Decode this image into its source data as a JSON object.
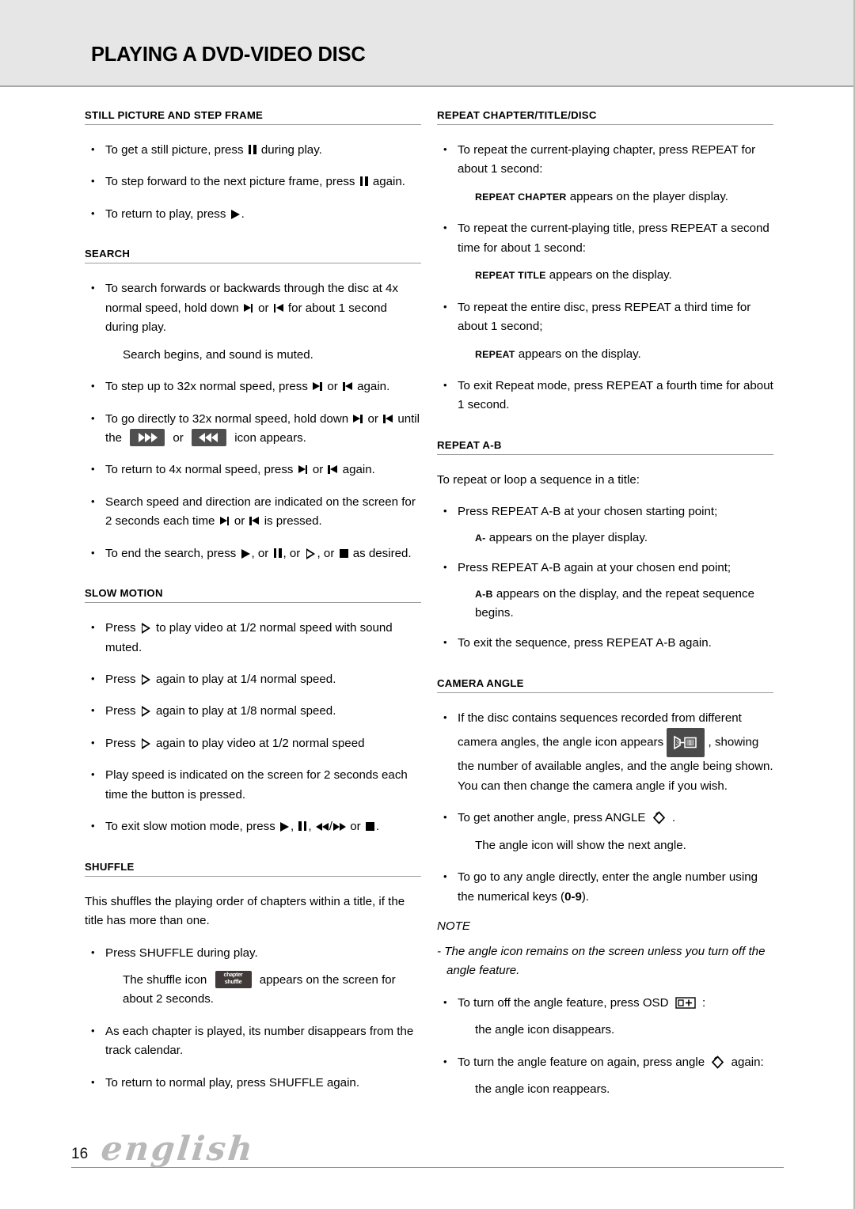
{
  "header": {
    "title": "PLAYING A DVD-VIDEO DISC"
  },
  "footer": {
    "page_number": "16",
    "language": "english"
  },
  "icons": {
    "pause": "pause-icon",
    "play": "play-icon",
    "slow": "slow-play-icon",
    "stop": "stop-icon",
    "next": "next-track-icon",
    "prev": "previous-track-icon",
    "rewind": "rewind-icon",
    "fast_forward": "fast-forward-icon",
    "angle": "camera-angle-icon",
    "osd": "osd-icon",
    "shuffle_box_line1": "chapter",
    "shuffle_box_line2": "shuffle"
  },
  "left_column": {
    "sections": [
      {
        "id": "still-picture-and-step-frame",
        "heading": "STILL PICTURE AND STEP FRAME",
        "items": [
          {
            "a": "To get a still picture, press",
            "b": "during play."
          },
          {
            "a": "To step forward to the next picture frame, press",
            "b": "again."
          },
          {
            "a": "To return to play, press",
            "b": "."
          }
        ]
      },
      {
        "id": "search",
        "heading": "SEARCH",
        "b1a": "To search forwards or backwards through the disc at 4x normal speed, hold down",
        "b1b": "or",
        "b1c": "for about 1 second during play.",
        "b1_sub": "Search begins, and sound is muted.",
        "b2a": "To step up to 32x normal speed, press",
        "b2b": "or",
        "b2c": "again.",
        "b3a": "To go directly to 32x normal speed, hold down",
        "b3b": "or",
        "b3c": "until the",
        "b3d": "or",
        "b3e": "icon appears.",
        "b4a": "To return to 4x normal speed, press",
        "b4b": "or",
        "b4c": "again.",
        "b5a": "Search speed and direction are indicated on the screen for 2 seconds each time",
        "b5b": "or",
        "b5c": "is pressed.",
        "b6a": "To end the search, press",
        "b6b": ", or",
        "b6c": ", or",
        "b6d": ", or",
        "b6e": "as desired."
      },
      {
        "id": "slow-motion",
        "heading": "SLOW MOTION",
        "b1a": "Press",
        "b1b": "to play video at 1/2 normal speed with sound muted.",
        "b2a": "Press",
        "b2b": "again to play at 1/4 normal speed.",
        "b3a": "Press",
        "b3b": "again to play at 1/8 normal speed.",
        "b4a": "Press",
        "b4b": "again to play video at 1/2 normal speed",
        "b5": "Play speed is indicated on the screen for 2 seconds each time the button is pressed.",
        "b6a": "To exit slow motion mode, press",
        "b6b": ",",
        "b6c": ",",
        "b6d": "/",
        "b6e": "or",
        "b6f": "."
      },
      {
        "id": "shuffle",
        "heading": "SHUFFLE",
        "intro": "This shuffles the playing order of chapters within a title, if the title has more than one.",
        "b1": "Press SHUFFLE during play.",
        "b1_sub_a": "The shuffle icon",
        "b1_sub_b": "appears on the screen for about 2 seconds.",
        "b2": "As each chapter is played, its number disappears from the track calendar.",
        "b3": "To return to normal play, press SHUFFLE again."
      }
    ]
  },
  "right_column": {
    "sections": [
      {
        "id": "repeat-chapter-title-disc",
        "heading": "REPEAT CHAPTER/TITLE/DISC",
        "b1": "To repeat the current-playing chapter, press REPEAT for about 1 second:",
        "b1_sub_label": "REPEAT CHAPTER",
        "b1_sub_text": "appears on the player display.",
        "b2": "To repeat the current-playing title, press REPEAT a second time for about 1 second:",
        "b2_sub_label": "REPEAT TITLE",
        "b2_sub_text": "appears on the display.",
        "b3": "To repeat the entire disc, press REPEAT a third time for about 1 second;",
        "b3_sub_label": "REPEAT",
        "b3_sub_text": "appears on the display.",
        "b4": "To exit Repeat mode, press REPEAT a fourth time for about 1 second."
      },
      {
        "id": "repeat-a-b",
        "heading": "REPEAT A-B",
        "intro": "To repeat or loop a sequence in a title:",
        "b1": "Press REPEAT A-B at your chosen starting point;",
        "b1_sub_label": "A-",
        "b1_sub_text": "appears on the player display.",
        "b2": "Press REPEAT A-B again at your chosen end point;",
        "b2_sub_label": "A-B",
        "b2_sub_text": "appears on the display, and the repeat sequence begins.",
        "b3": "To exit the sequence, press REPEAT A-B again."
      },
      {
        "id": "camera-angle",
        "heading": "CAMERA ANGLE",
        "b1a": "If the disc contains sequences recorded from different camera angles, the angle  icon appears",
        "b1b": ",",
        "b1c": "showing the number of available angles, and the angle being shown. You can then change the camera angle if you wish.",
        "b2a": "To get another angle, press ANGLE",
        "b2b": ".",
        "b2_sub": "The angle icon will show the next angle.",
        "b3a": "To go to any angle directly, enter the angle number using the numerical keys  (",
        "b3_bold": "0-9",
        "b3b": ").",
        "note_head": "NOTE",
        "note_text": "- The angle icon remains on the screen unless you turn off the angle feature.",
        "b4a": "To turn off the angle feature, press OSD",
        "b4b": ":",
        "b4_sub": "the angle icon disappears.",
        "b5a": "To turn the angle feature on again, press angle",
        "b5b": "again:",
        "b5_sub": "the angle icon reappears."
      }
    ]
  }
}
